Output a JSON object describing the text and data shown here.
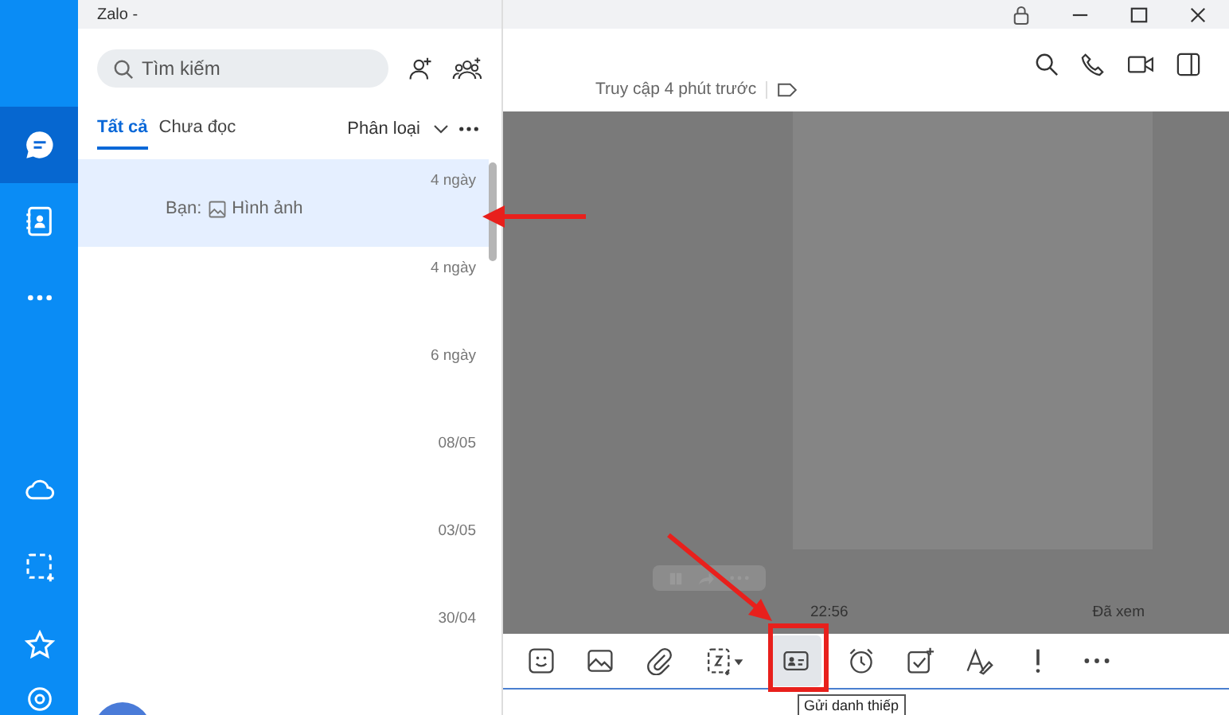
{
  "window": {
    "title": "Zalo -"
  },
  "nav": {
    "items": [
      {
        "kind": "chat",
        "selected": true
      },
      {
        "kind": "contacts",
        "selected": false
      },
      {
        "kind": "more",
        "selected": false
      }
    ],
    "bottom": [
      {
        "kind": "cloud"
      },
      {
        "kind": "capture"
      },
      {
        "kind": "star"
      }
    ]
  },
  "search": {
    "placeholder": "Tìm kiếm"
  },
  "filters": {
    "tabs": [
      {
        "label": "Tất cả",
        "selected": true
      },
      {
        "label": "Chưa đọc",
        "selected": false
      }
    ],
    "classify": "Phân loại"
  },
  "conversations": [
    {
      "time": "4 ngày",
      "preview_prefix": "Bạn:",
      "preview": "Hình ảnh",
      "selected": true
    },
    {
      "time": "4 ngày",
      "selected": false
    },
    {
      "time": "6 ngày",
      "selected": false
    },
    {
      "time": "08/05",
      "selected": false
    },
    {
      "time": "03/05",
      "selected": false
    },
    {
      "time": "30/04",
      "selected": false
    }
  ],
  "chat": {
    "status": "Truy cập 4 phút trước",
    "message_time": "22:56",
    "seen": "Đã xem"
  },
  "toolbar": [
    {
      "kind": "sticker"
    },
    {
      "kind": "image"
    },
    {
      "kind": "attach"
    },
    {
      "kind": "capture"
    },
    {
      "kind": "card",
      "selected": true
    },
    {
      "kind": "alarm"
    },
    {
      "kind": "todo"
    },
    {
      "kind": "format"
    },
    {
      "kind": "urgent"
    },
    {
      "kind": "more"
    }
  ],
  "tooltip": "Gửi danh thiếp"
}
